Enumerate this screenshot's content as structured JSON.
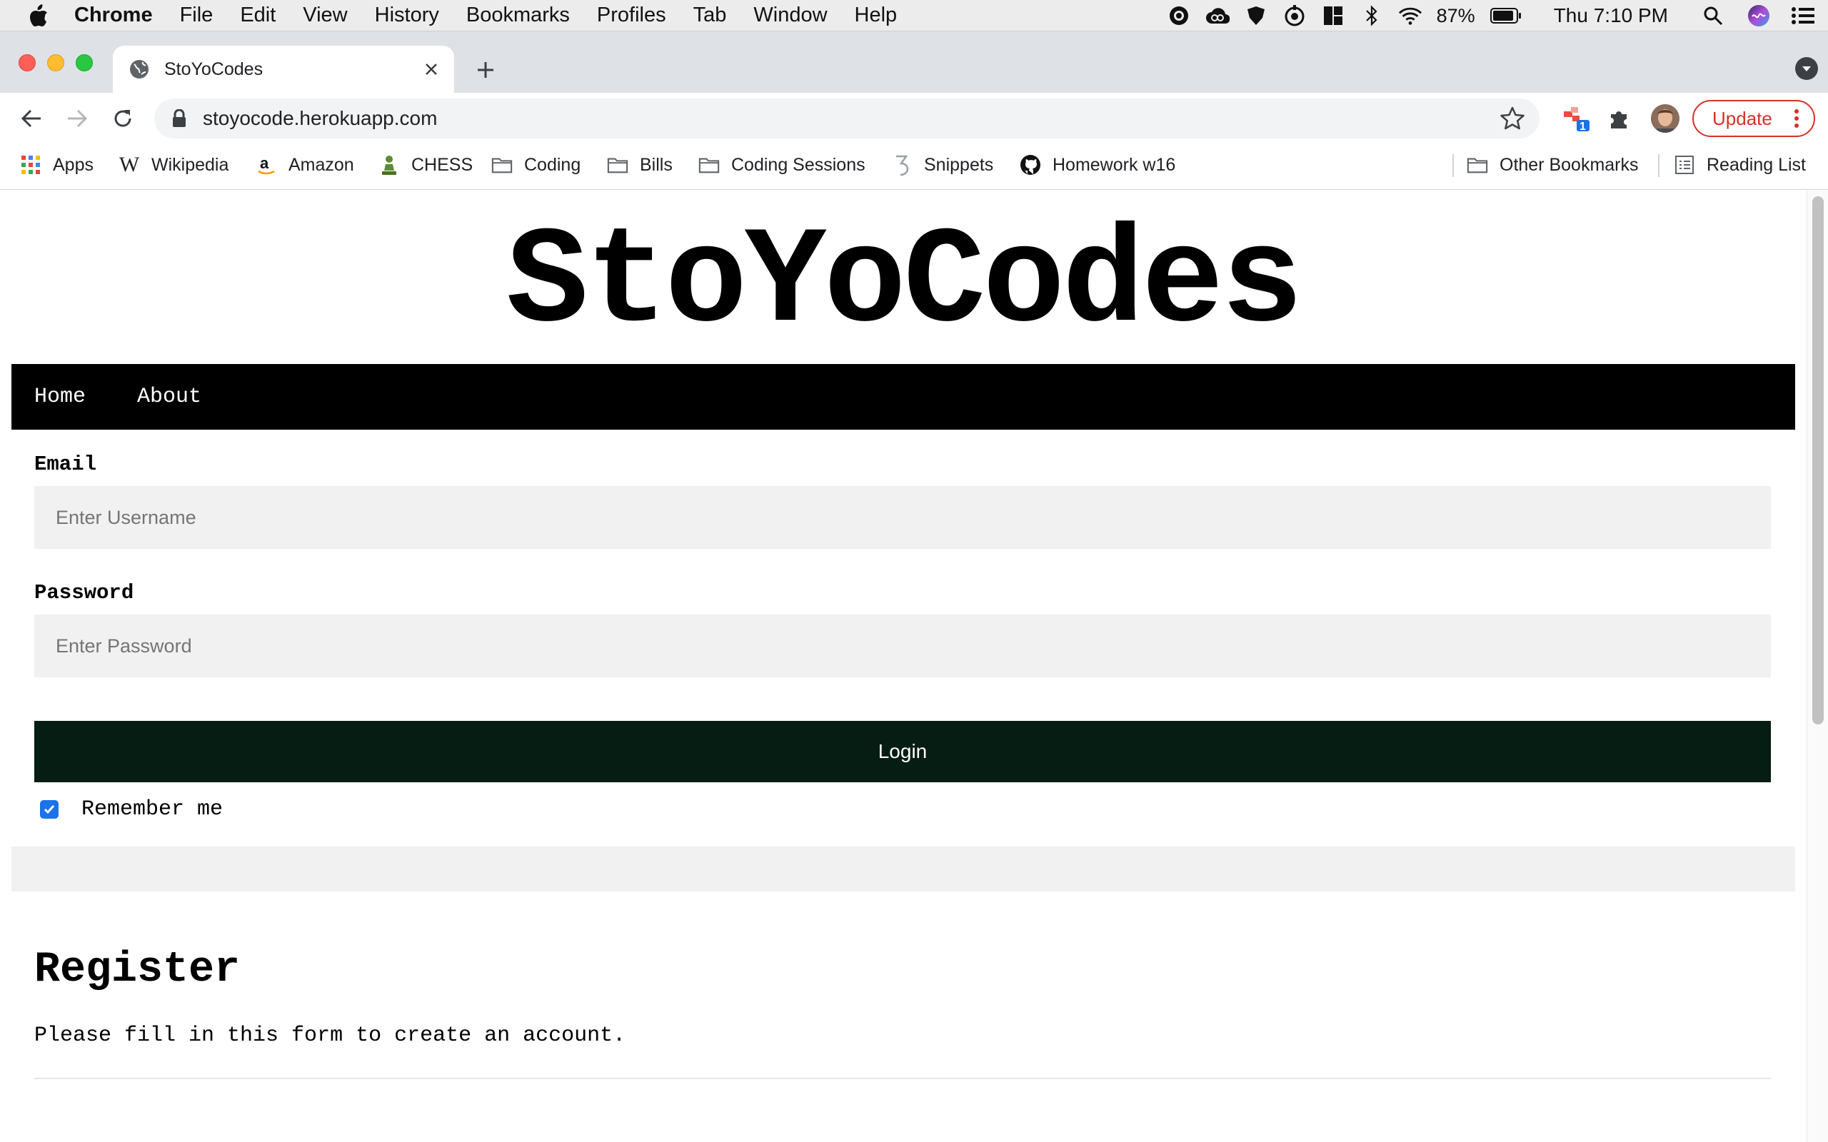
{
  "menubar": {
    "app_name": "Chrome",
    "items": [
      "File",
      "Edit",
      "View",
      "History",
      "Bookmarks",
      "Profiles",
      "Tab",
      "Window",
      "Help"
    ],
    "battery": "87%",
    "clock": "Thu 7:10 PM"
  },
  "browser": {
    "tab_title": "StoYoCodes",
    "url": "stoyocode.herokuapp.com",
    "update_label": "Update",
    "extension_badge": "1",
    "bookmarks": [
      "Apps",
      "Wikipedia",
      "Amazon",
      "CHESS",
      "Coding",
      "Bills",
      "Coding Sessions",
      "Snippets",
      "Homework w16"
    ],
    "other_bookmarks": "Other Bookmarks",
    "reading_list": "Reading List"
  },
  "page": {
    "site_title": "StoYoCodes",
    "nav": [
      "Home",
      "About"
    ],
    "login": {
      "email_label": "Email",
      "email_placeholder": "Enter Username",
      "password_label": "Password",
      "password_placeholder": "Enter Password",
      "button": "Login",
      "remember_label": "Remember me",
      "remember_checked": true
    },
    "register": {
      "heading": "Register",
      "subtitle": "Please fill in this form to create an account."
    }
  },
  "colors": {
    "nav_bg": "#000000",
    "login_button_bg": "#061d13",
    "field_bg": "#f1f1f1",
    "update_red": "#d93025",
    "checkbox_blue": "#1a73e8"
  }
}
